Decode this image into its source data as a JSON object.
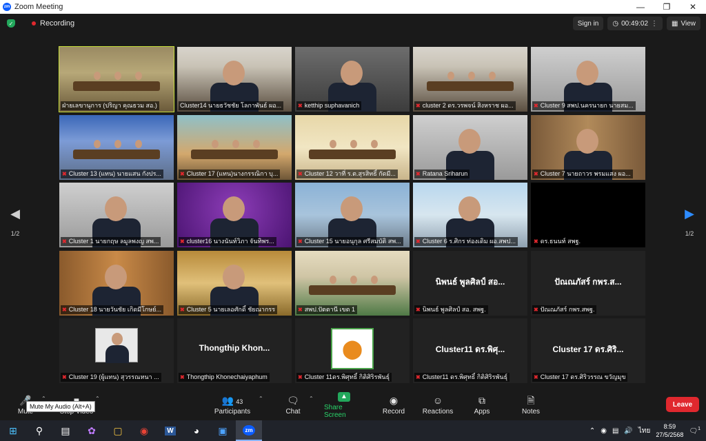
{
  "window": {
    "title": "Zoom Meeting"
  },
  "topbar": {
    "recording": "Recording",
    "sign_in": "Sign in",
    "timer": "00:49:02",
    "view": "View"
  },
  "pagination": {
    "left": "1/2",
    "right": "1/2"
  },
  "tiles": [
    {
      "name": "ฝ่ายเลขานุการ (ปริญา  คุณธวม สอ.)",
      "muted": false,
      "bg": "bg-room1",
      "kind": "room",
      "active": true
    },
    {
      "name": "Cluster14 นายธวัชชัย โลกาพันธ์ ผอ...",
      "muted": false,
      "bg": "bg-room2",
      "kind": "person"
    },
    {
      "name": "ketthip suphavanich",
      "muted": true,
      "bg": "bg-office",
      "kind": "person"
    },
    {
      "name": "cluster 2 ดร.วรพจน์ สิงหราช ผอ...",
      "muted": true,
      "bg": "bg-room2",
      "kind": "room"
    },
    {
      "name": "Cluster 9 สพป.นครนายก นายสม...",
      "muted": true,
      "bg": "bg-gray",
      "kind": "person"
    },
    {
      "name": "Cluster 13 (แทน) นายแสน กังปร...",
      "muted": true,
      "bg": "bg-blue",
      "kind": "room"
    },
    {
      "name": "Cluster 17 (แทน)นางกรรณิกา บุ...",
      "muted": true,
      "bg": "bg-teal",
      "kind": "room"
    },
    {
      "name": "Cluster 12 วาที่ ร.ต.สุรสิทธิ์ กัดมี...",
      "muted": true,
      "bg": "bg-school",
      "kind": "room"
    },
    {
      "name": "Ratana Sriharun",
      "muted": true,
      "bg": "bg-gray",
      "kind": "person"
    },
    {
      "name": "Cluster 7 นายถาวร พรมแสง ผอ...",
      "muted": true,
      "bg": "bg-curtain",
      "kind": "person"
    },
    {
      "name": "Cluster 1 นายกฤษ ลมูลพงญ สพ...",
      "muted": true,
      "bg": "bg-gray",
      "kind": "person"
    },
    {
      "name": "cluster16 นางนันท์วิภา จันทิพร...",
      "muted": true,
      "bg": "bg-purple",
      "kind": "person"
    },
    {
      "name": "Cluster 15 นายอนุกุล ศรีสมบัติ สพ...",
      "muted": true,
      "bg": "bg-mount",
      "kind": "person"
    },
    {
      "name": "Cluster 6 ร.ศิกร ท่องเดิม ผอ.สพป...",
      "muted": true,
      "bg": "bg-sky",
      "kind": "person"
    },
    {
      "name": "ดร.ธนนท์ สพฐ.",
      "muted": true,
      "bg": "bg-dark",
      "kind": "none"
    },
    {
      "name": "Cluster 18 นายวันชัย เกิดมีโกษย์...",
      "muted": true,
      "bg": "bg-wood",
      "kind": "person"
    },
    {
      "name": "Cluster 5 นายเลอศักดิ์ ชัยณากรร",
      "muted": true,
      "bg": "bg-gold",
      "kind": "person"
    },
    {
      "name": "สพป.ปัตตานี เขต 1",
      "muted": true,
      "bg": "bg-green",
      "kind": "room"
    },
    {
      "name": "นิพนธ์ พูลศิลป์ สอ. สพฐ.",
      "muted": true,
      "bg": "bg-plain",
      "kind": "text",
      "big": "นิพนธ์ พูลศิลป์ สอ..."
    },
    {
      "name": "ปัณณภัสร์ กพร.สพฐ.",
      "muted": true,
      "bg": "bg-plain",
      "kind": "text",
      "big": "ปัณณภัสร์ กพร.ส..."
    },
    {
      "name": "Cluster 19 (ผู้แทน) สุวรรณหนา ...",
      "muted": true,
      "bg": "bg-plain",
      "kind": "photo"
    },
    {
      "name": "Thongthip Khonechaiyaphum",
      "muted": true,
      "bg": "bg-plain",
      "kind": "text",
      "big": "Thongthip  Khon..."
    },
    {
      "name": "Cluster 11ดร.พิศุทธิ์  กิติศิริรพันธุ์",
      "muted": true,
      "bg": "bg-plain",
      "kind": "logo"
    },
    {
      "name": "Cluster11 ดร.พิศุทธิ์ กิติศิริรพันธุ์",
      "muted": true,
      "bg": "bg-plain",
      "kind": "text",
      "big": "Cluster11 ดร.พิศุ..."
    },
    {
      "name": "Cluster 17 ดร.ศิริวรรณ ขวัญมุข",
      "muted": true,
      "bg": "bg-plain",
      "kind": "text",
      "big": "Cluster 17 ดร.ศิริ..."
    }
  ],
  "toolbar": {
    "mute": "Mute",
    "stop_video": "Stop Video",
    "participants": "Participants",
    "participants_count": "43",
    "chat": "Chat",
    "share": "Share Screen",
    "record": "Record",
    "reactions": "Reactions",
    "apps": "Apps",
    "notes": "Notes",
    "leave": "Leave",
    "tooltip": "Mute My Audio (Alt+A)"
  },
  "taskbar": {
    "lang": "ไทย",
    "time": "8:59",
    "date": "27/5/2568",
    "notif_count": "1"
  }
}
